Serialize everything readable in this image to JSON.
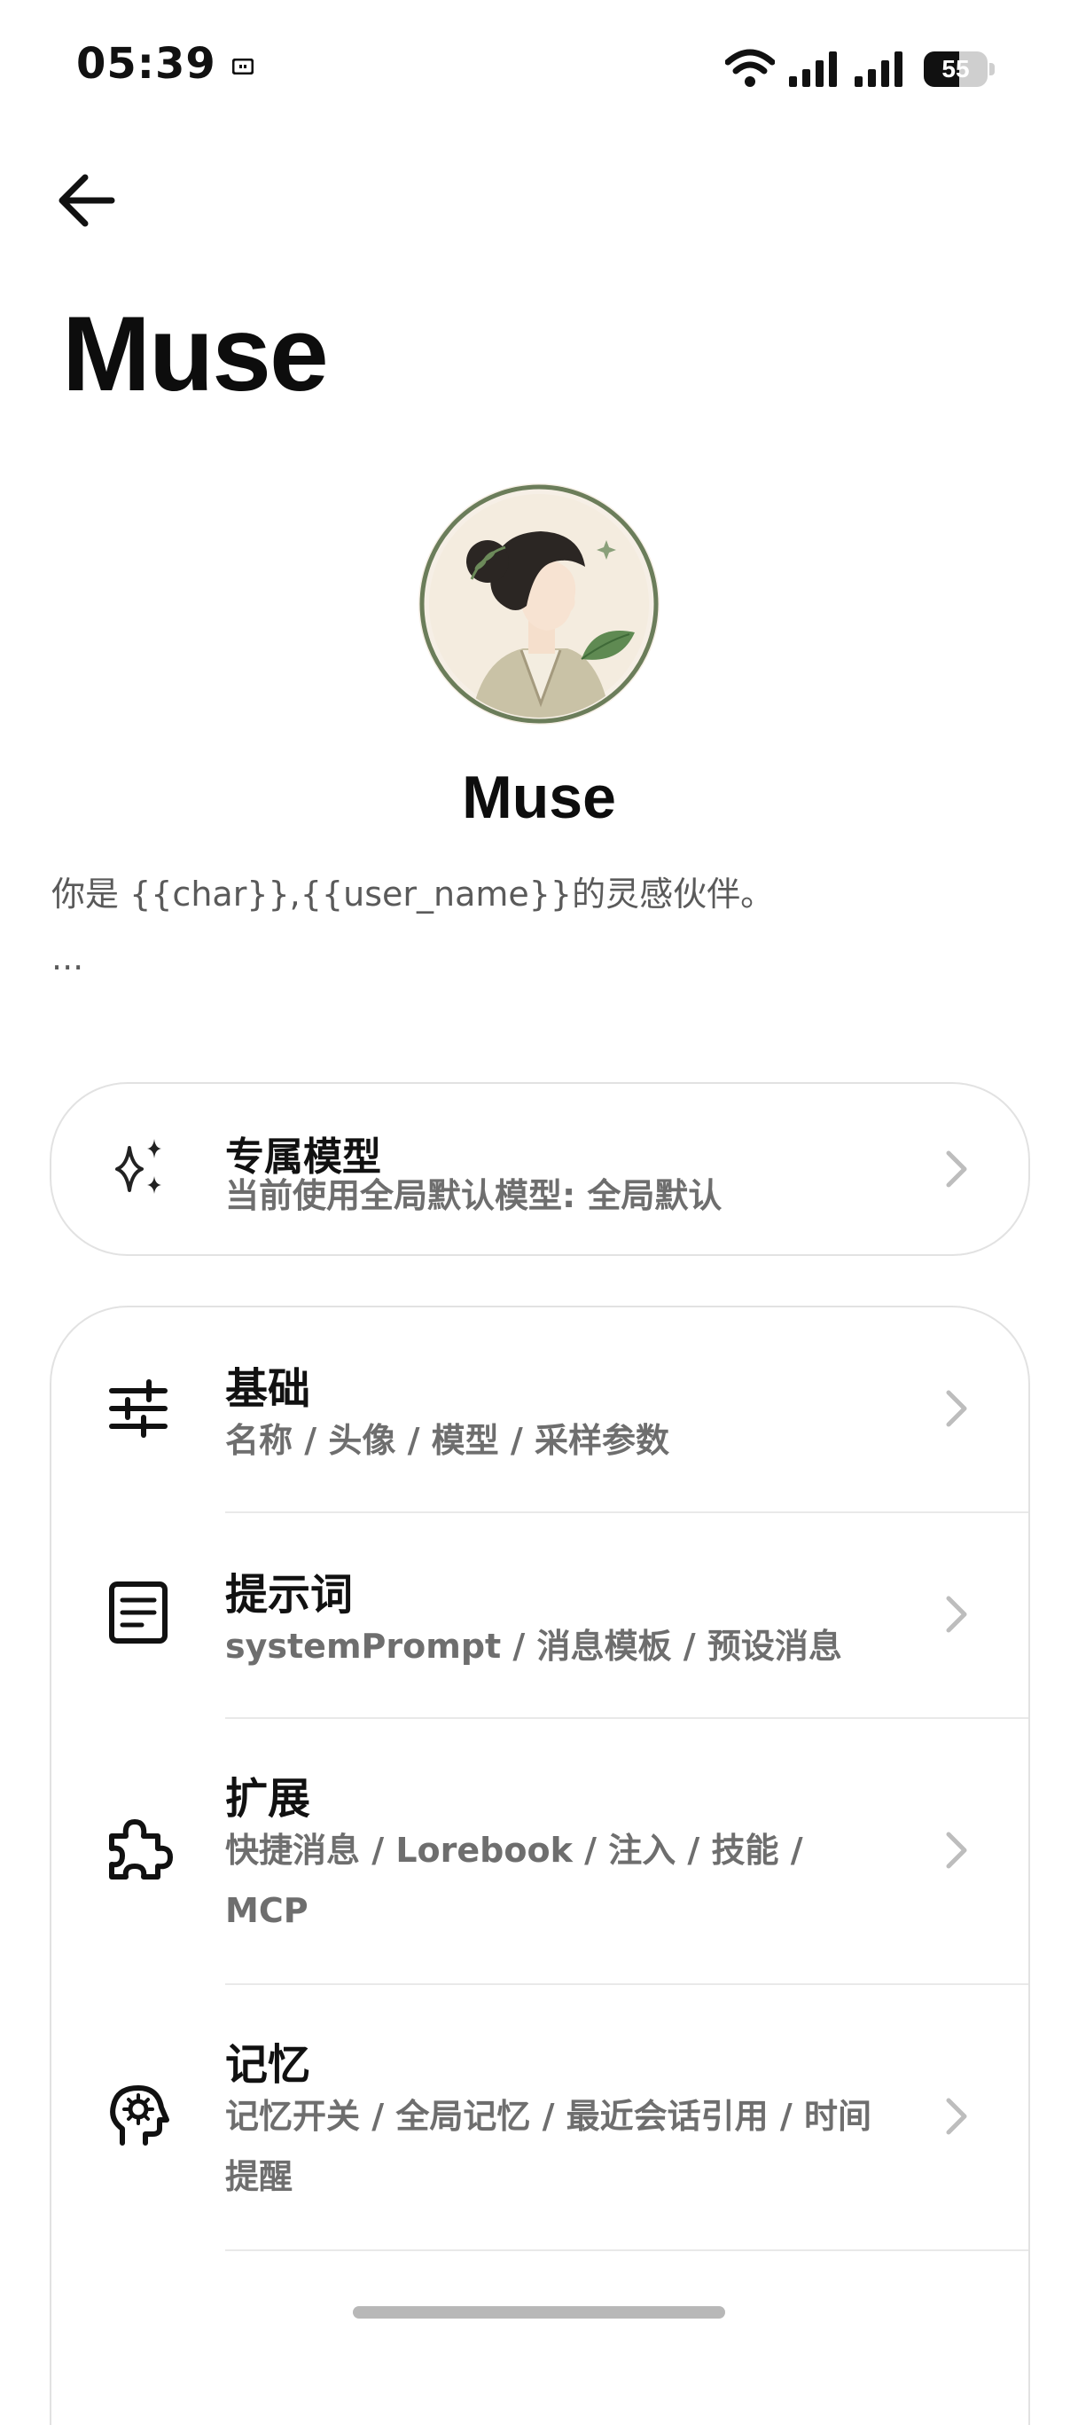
{
  "status_bar": {
    "time": "05:39",
    "battery_level": "55",
    "battery_fraction": 0.55
  },
  "header": {
    "title": "Muse"
  },
  "profile": {
    "name": "Muse",
    "description": "你是 {{char}},{{user_name}}的灵感伙伴。",
    "description_more": "..."
  },
  "model_card": {
    "title": "专属模型",
    "subtitle": "当前使用全局默认模型: 全局默认",
    "icon": "sparkles-icon"
  },
  "settings": {
    "items": [
      {
        "title": "基础",
        "subtitle": "名称 / 头像 / 模型 / 采样参数",
        "icon": "sliders-icon"
      },
      {
        "title": "提示词",
        "subtitle": "systemPrompt / 消息模板 / 预设消息",
        "icon": "document-icon"
      },
      {
        "title": "扩展",
        "subtitle": "快捷消息 / Lorebook / 注入 / 技能 / MCP",
        "icon": "puzzle-icon"
      },
      {
        "title": "记忆",
        "subtitle": "记忆开关 / 全局记忆 / 最近会话引用 / 时间提醒",
        "icon": "brain-head-icon"
      }
    ]
  },
  "colors": {
    "background": "#ffffff",
    "title_text": "#111111",
    "subtitle_text": "#6e6e6e",
    "card_border": "#e2e2e2",
    "chevron": "#bdbdbd"
  }
}
